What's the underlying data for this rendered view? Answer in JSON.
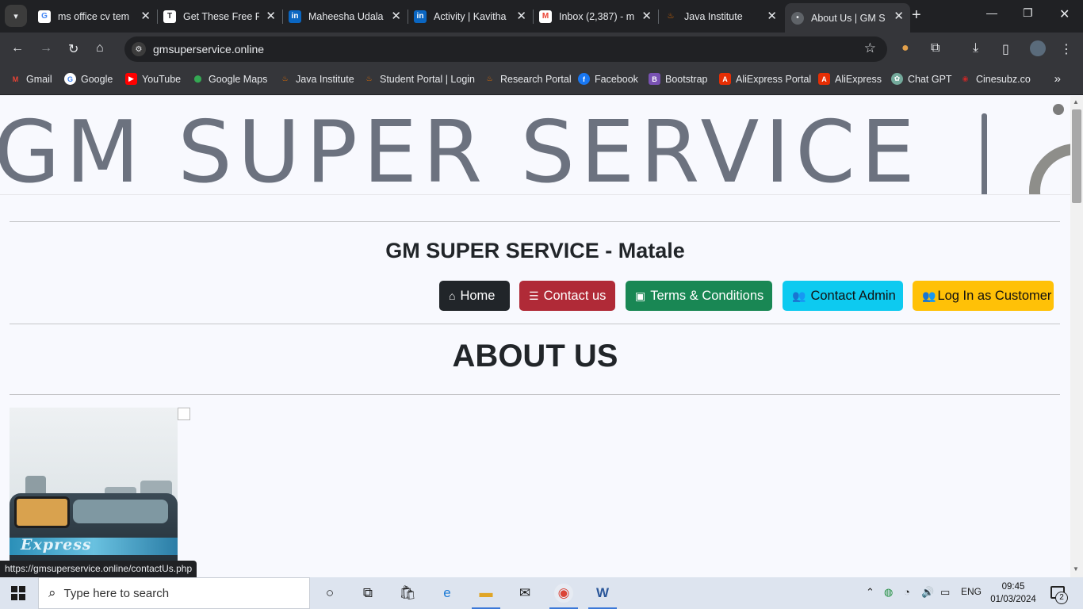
{
  "browser": {
    "tabs": [
      {
        "title": "ms office cv tem",
        "icon": "google-icon",
        "color": "#4285f4"
      },
      {
        "title": "Get These Free F",
        "icon": "site-icon",
        "color": "#ffffff"
      },
      {
        "title": "Maheesha Udala",
        "icon": "linkedin-icon",
        "color": "#0a66c2"
      },
      {
        "title": "Activity | Kavitha",
        "icon": "linkedin-icon",
        "color": "#0a66c2"
      },
      {
        "title": "Inbox (2,387) - m",
        "icon": "gmail-icon",
        "color": "#ea4335"
      },
      {
        "title": "Java Institute",
        "icon": "java-icon",
        "color": "#e76f00"
      },
      {
        "title": "About Us | GM S",
        "icon": "page-icon",
        "color": "#9aa0a6"
      }
    ],
    "url": "gmsuperservice.online",
    "bookmarks": [
      {
        "label": "Gmail",
        "icon": "gmail-icon",
        "color": "#ea4335"
      },
      {
        "label": "Google",
        "icon": "google-icon",
        "color": "#4285f4"
      },
      {
        "label": "YouTube",
        "icon": "youtube-icon",
        "color": "#ff0000"
      },
      {
        "label": "Google Maps",
        "icon": "maps-icon",
        "color": "#34a853"
      },
      {
        "label": "Java Institute",
        "icon": "java-icon",
        "color": "#e76f00"
      },
      {
        "label": "Student Portal | Login",
        "icon": "java-icon",
        "color": "#e76f00"
      },
      {
        "label": "Research Portal",
        "icon": "java-icon",
        "color": "#e76f00"
      },
      {
        "label": "Facebook",
        "icon": "facebook-icon",
        "color": "#1877f2"
      },
      {
        "label": "Bootstrap",
        "icon": "bootstrap-icon",
        "color": "#7952b3"
      },
      {
        "label": "AliExpress Portal",
        "icon": "aliexpress-icon",
        "color": "#e62e04"
      },
      {
        "label": "AliExpress",
        "icon": "aliexpress-icon",
        "color": "#e62e04"
      },
      {
        "label": "Chat GPT",
        "icon": "chatgpt-icon",
        "color": "#74aa9c"
      },
      {
        "label": "Cinesubz.co",
        "icon": "cinesubz-icon",
        "color": "#c62828"
      }
    ],
    "status_url": "https://gmsuperservice.online/contactUs.php"
  },
  "page": {
    "banner_text": "GM SUPER SERVICE",
    "site_title": "GM SUPER SERVICE - Matale",
    "nav": [
      {
        "label": "Home",
        "icon": "house-icon",
        "color": "#212529"
      },
      {
        "label": "Contact us",
        "icon": "contact-list-icon",
        "color": "#b02a37"
      },
      {
        "label": "Terms & Conditions",
        "icon": "id-card-icon",
        "color": "#198754"
      },
      {
        "label": "Contact Admin",
        "icon": "users-icon",
        "color": "#0dcaf0"
      },
      {
        "label": "Log In as Customer",
        "icon": "users-icon",
        "color": "#ffc107"
      }
    ],
    "heading": "ABOUT US",
    "photo_text": "Express"
  },
  "taskbar": {
    "search_placeholder": "Type here to search",
    "language": "ENG",
    "time": "09:45",
    "date": "01/03/2024",
    "notification_count": "2"
  }
}
